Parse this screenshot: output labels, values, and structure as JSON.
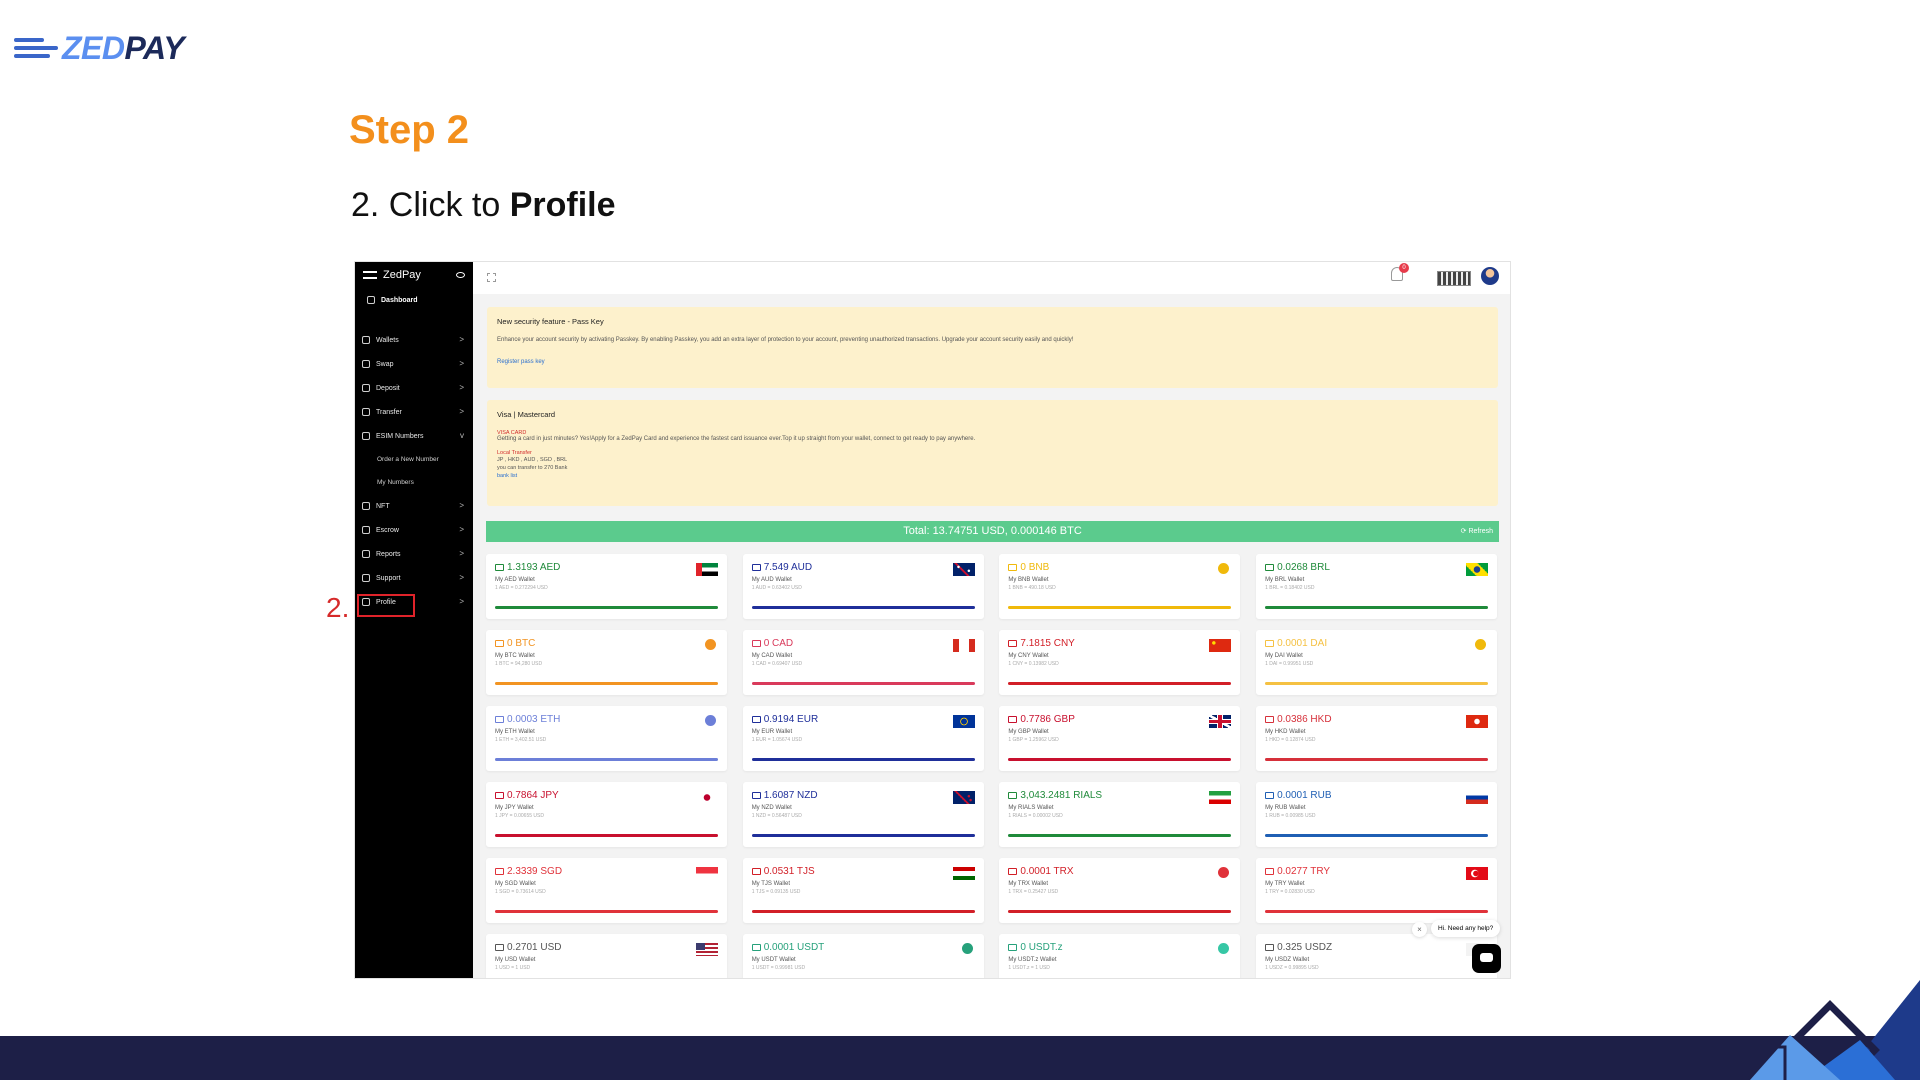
{
  "slide": {
    "brand_name_part1": "ZED",
    "brand_name_part2": "PAY",
    "step_title": "Step 2",
    "instruction_prefix": "2. Click to ",
    "instruction_bold": "Profile",
    "step_marker": "2."
  },
  "app": {
    "brand": "ZedPay",
    "sidebar": [
      {
        "label": "Dashboard",
        "icon": "home-icon",
        "kind": "dash"
      },
      {
        "label": "Wallets",
        "icon": "wallet-icon",
        "chevron": ">"
      },
      {
        "label": "Swap",
        "icon": "swap-icon",
        "chevron": ">"
      },
      {
        "label": "Deposit",
        "icon": "deposit-icon",
        "chevron": ">"
      },
      {
        "label": "Transfer",
        "icon": "transfer-icon",
        "chevron": ">"
      },
      {
        "label": "ESIM Numbers",
        "icon": "sim-icon",
        "chevron": "v"
      },
      {
        "label": "Order a New Number",
        "kind": "sub"
      },
      {
        "label": "My Numbers",
        "kind": "sub"
      },
      {
        "label": "NFT",
        "icon": "image-icon",
        "chevron": ">"
      },
      {
        "label": "Escrow",
        "icon": "escrow-icon",
        "chevron": ">"
      },
      {
        "label": "Reports",
        "icon": "reports-icon",
        "chevron": ">"
      },
      {
        "label": "Support",
        "icon": "support-icon",
        "chevron": ">"
      },
      {
        "label": "Profile",
        "icon": "user-icon",
        "chevron": ">",
        "kind": "profile"
      }
    ],
    "notification_count": "0",
    "notice1": {
      "title": "New security feature - Pass Key",
      "body": "Enhance your account security by activating Passkey. By enabling Passkey, you add an extra layer of protection to your account, preventing unauthorized transactions. Upgrade your account security easily and quickly!",
      "link": "Register pass key"
    },
    "notice2": {
      "title": "Visa | Mastercard",
      "card_label": "VISA CARD",
      "card_text": "Getting a card in just minutes? Yes!Apply for a ZedPay Card and experience the fastest card issuance ever.Top it up straight from your wallet, connect to get ready to pay anywhere.",
      "local_label": "Local Transfer",
      "local_line1": "JP , HKD , AUD , SGD , BRL",
      "local_line2": "you can transfer to 270 Bank",
      "local_link": "bank list"
    },
    "total": "Total: 13.74751 USD, 0.000146 BTC",
    "refresh": "Refresh",
    "wallets": [
      {
        "amount": "1.3193 AED",
        "name": "My AED Wallet",
        "rate": "1 AED = 0.272294 USD",
        "color": "#1f8a3a",
        "flag": "aed"
      },
      {
        "amount": "7.549 AUD",
        "name": "My AUD Wallet",
        "rate": "1 AUD = 0.63402 USD",
        "color": "#1f2f9a",
        "flag": "aud"
      },
      {
        "amount": "0 BNB",
        "name": "My BNB Wallet",
        "rate": "1 BNB = 490.18 USD",
        "color": "#f0b90b",
        "flag": "coin-yellow"
      },
      {
        "amount": "0.0268 BRL",
        "name": "My BRL Wallet",
        "rate": "1 BRL = 0.18402 USD",
        "color": "#1f8a3a",
        "flag": "brl"
      },
      {
        "amount": "0 BTC",
        "name": "My BTC Wallet",
        "rate": "1 BTC = 94,280 USD",
        "color": "#f29422",
        "flag": "coin-orange"
      },
      {
        "amount": "0 CAD",
        "name": "My CAD Wallet",
        "rate": "1 CAD = 0.69407 USD",
        "color": "#d93a5b",
        "flag": "cad"
      },
      {
        "amount": "7.1815 CNY",
        "name": "My CNY Wallet",
        "rate": "1 CNY = 0.13982 USD",
        "color": "#d21f27",
        "flag": "cny"
      },
      {
        "amount": "0.0001 DAI",
        "name": "My DAI Wallet",
        "rate": "1 DAI = 0.99951 USD",
        "color": "#f5c142",
        "flag": "coin-yellow"
      },
      {
        "amount": "0.0003 ETH",
        "name": "My ETH Wallet",
        "rate": "1 ETH = 3,402.51 USD",
        "color": "#6c7fd8",
        "flag": "coin-blue"
      },
      {
        "amount": "0.9194 EUR",
        "name": "My EUR Wallet",
        "rate": "1 EUR = 1.05674 USD",
        "color": "#1f2f9a",
        "flag": "eur"
      },
      {
        "amount": "0.7786 GBP",
        "name": "My GBP Wallet",
        "rate": "1 GBP = 1.25962 USD",
        "color": "#c8102e",
        "flag": "gbp"
      },
      {
        "amount": "0.0386 HKD",
        "name": "My HKD Wallet",
        "rate": "1 HKD = 0.12874 USD",
        "color": "#d6303a",
        "flag": "hkd"
      },
      {
        "amount": "0.7864 JPY",
        "name": "My JPY Wallet",
        "rate": "1 JPY = 0.00655 USD",
        "color": "#c8102e",
        "flag": "jpy"
      },
      {
        "amount": "1.6087 NZD",
        "name": "My NZD Wallet",
        "rate": "1 NZD = 0.56487 USD",
        "color": "#1f2f9a",
        "flag": "nzd"
      },
      {
        "amount": "3,043.2481 RIALS",
        "name": "My RIALS Wallet",
        "rate": "1 RIALS = 0.00002 USD",
        "color": "#1f8a3a",
        "flag": "irr"
      },
      {
        "amount": "0.0001 RUB",
        "name": "My RUB Wallet",
        "rate": "1 RUB = 0.00985 USD",
        "color": "#1f5fb4",
        "flag": "rub"
      },
      {
        "amount": "2.3339 SGD",
        "name": "My SGD Wallet",
        "rate": "1 SGD = 0.73614 USD",
        "color": "#e0323a",
        "flag": "sgd"
      },
      {
        "amount": "0.0531 TJS",
        "name": "My TJS Wallet",
        "rate": "1 TJS = 0.09135 USD",
        "color": "#d21f27",
        "flag": "tjs"
      },
      {
        "amount": "0.0001 TRX",
        "name": "My TRX Wallet",
        "rate": "1 TRX = 0.25427 USD",
        "color": "#d21f27",
        "flag": "coin-red"
      },
      {
        "amount": "0.0277 TRY",
        "name": "My TRY Wallet",
        "rate": "1 TRY = 0.02830 USD",
        "color": "#e0323a",
        "flag": "try"
      },
      {
        "amount": "0.2701 USD",
        "name": "My USD Wallet",
        "rate": "1 USD = 1 USD",
        "color": "#555555",
        "flag": "usd"
      },
      {
        "amount": "0.0001 USDT",
        "name": "My USDT Wallet",
        "rate": "1 USDT = 0.99981 USD",
        "color": "#26a17b",
        "flag": "coin-green"
      },
      {
        "amount": "0 USDT.z",
        "name": "My USDT.z Wallet",
        "rate": "1 USDT.z = 1 USD",
        "color": "#26a17b",
        "flag": "coin-gem"
      },
      {
        "amount": "0.325 USDZ",
        "name": "My USDZ Wallet",
        "rate": "1 USDZ = 0.99895 USD",
        "color": "#555555",
        "flag": "usdz"
      }
    ],
    "chat_tip": "Hi. Need any help?",
    "chat_close": "×"
  }
}
